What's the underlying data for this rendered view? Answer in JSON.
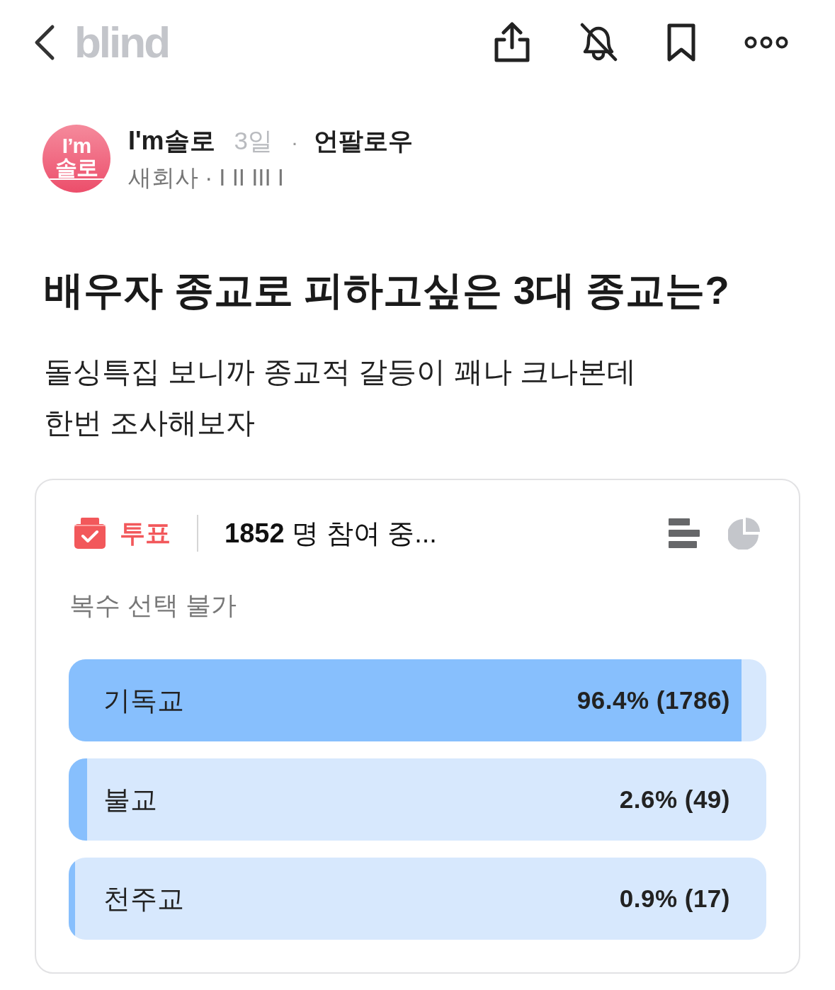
{
  "top_bar": {
    "logo": "blind"
  },
  "author": {
    "avatar_lines": [
      "I’m",
      "솔로"
    ],
    "name": "I'm솔로",
    "time": "3일",
    "separator": "·",
    "follow_link": "언팔로우",
    "company": "새회사 · I II III I"
  },
  "post": {
    "title": "배우자 종교로 피하고싶은 3대 종교는?",
    "body": "돌싱특집 보니까 종교적 갈등이 꽤나 크나본데\n한번 조사해보자"
  },
  "poll": {
    "label": "투표",
    "participants": "**1852** 명 참여 중...",
    "view_toggles": [
      {
        "kind": "bars",
        "selected": true
      },
      {
        "kind": "pie",
        "selected": false
      }
    ],
    "rule": "복수 선택 불가",
    "options": [
      {
        "label": "기독교",
        "result": "96.4% (1786)",
        "level": 0.964
      },
      {
        "label": "불교",
        "result": "2.6% (49)",
        "level": 0.026
      },
      {
        "label": "천주교",
        "result": "0.9% (17)",
        "level": 0.009
      }
    ]
  }
}
